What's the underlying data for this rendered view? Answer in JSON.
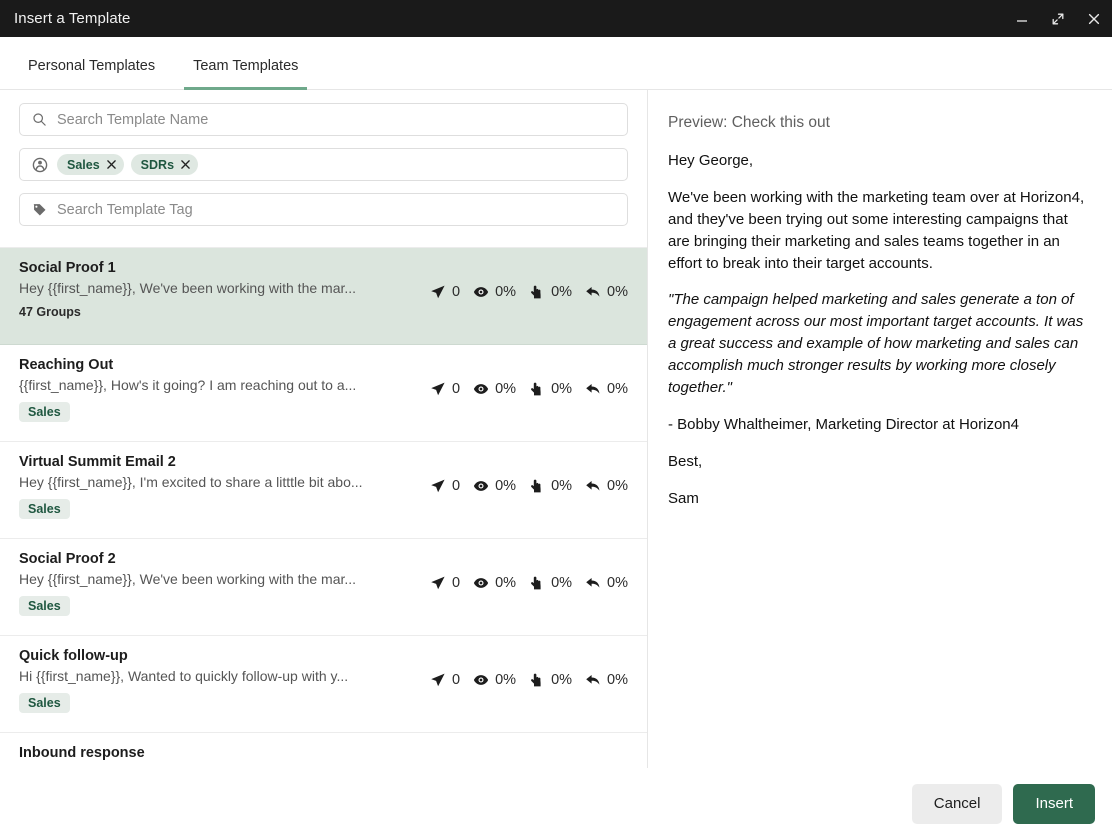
{
  "window": {
    "title": "Insert a Template",
    "controls": [
      {
        "name": "minimize",
        "label": "Minimize"
      },
      {
        "name": "maximize",
        "label": "Maximize"
      },
      {
        "name": "close",
        "label": "Close"
      }
    ]
  },
  "tabs": [
    {
      "label": "Personal Templates",
      "active": false
    },
    {
      "label": "Team Templates",
      "active": true
    }
  ],
  "filters": {
    "name_search": {
      "placeholder": "Search Template Name",
      "value": "",
      "icon": "search-icon"
    },
    "group_filter": {
      "icon": "group-people-icon",
      "chips": [
        {
          "label": "Sales"
        },
        {
          "label": "SDRs"
        }
      ]
    },
    "tag_search": {
      "placeholder": "Search Template Tag",
      "value": "",
      "icon": "tag-icon"
    }
  },
  "stat_labels": {
    "sent": "sent-icon",
    "opened": "eye-icon",
    "clicked": "click-hand-icon",
    "replied": "reply-arrow-icon"
  },
  "templates": [
    {
      "title": "Social Proof 1",
      "snippet": "Hey {{first_name}}, We've been working with the mar...",
      "meta": "47 Groups",
      "meta_type": "groups",
      "selected": true,
      "stats": {
        "sent": "0",
        "opened": "0%",
        "clicked": "0%",
        "replied": "0%"
      }
    },
    {
      "title": "Reaching Out",
      "snippet": "{{first_name}}, How's it going? I am reaching out to a...",
      "meta": "Sales",
      "meta_type": "tag",
      "selected": false,
      "stats": {
        "sent": "0",
        "opened": "0%",
        "clicked": "0%",
        "replied": "0%"
      }
    },
    {
      "title": "Virtual Summit Email 2",
      "snippet": "Hey {{first_name}}, I'm excited to share a litttle bit abo...",
      "meta": "Sales",
      "meta_type": "tag",
      "selected": false,
      "stats": {
        "sent": "0",
        "opened": "0%",
        "clicked": "0%",
        "replied": "0%"
      }
    },
    {
      "title": "Social Proof 2",
      "snippet": "Hey {{first_name}}, We've been working with the mar...",
      "meta": "Sales",
      "meta_type": "tag",
      "selected": false,
      "stats": {
        "sent": "0",
        "opened": "0%",
        "clicked": "0%",
        "replied": "0%"
      }
    },
    {
      "title": "Quick follow-up",
      "snippet": "Hi {{first_name}}, Wanted to quickly follow-up with y...",
      "meta": "Sales",
      "meta_type": "tag",
      "selected": false,
      "stats": {
        "sent": "0",
        "opened": "0%",
        "clicked": "0%",
        "replied": "0%"
      }
    },
    {
      "title": "Inbound response",
      "snippet": "",
      "meta": "",
      "meta_type": "none",
      "selected": false,
      "stats": {
        "sent": "",
        "opened": "",
        "clicked": "",
        "replied": ""
      }
    }
  ],
  "preview": {
    "subject": "Preview: Check this out",
    "paragraphs": [
      {
        "text": "Hey George,",
        "style": "normal"
      },
      {
        "text": "We've been working with the marketing team over at Horizon4, and they've been trying out some interesting campaigns that are bringing their marketing and sales teams together in an effort to break into their target accounts.",
        "style": "normal"
      },
      {
        "text": "\"The campaign helped marketing and sales generate a ton of engagement across our most important target accounts. It was a great success and example of how marketing and sales can accomplish much stronger results by working more closely together.\"",
        "style": "quote"
      },
      {
        "text": "- Bobby Whaltheimer, Marketing Director at Horizon4",
        "style": "normal"
      },
      {
        "text": "Best,",
        "style": "normal"
      },
      {
        "text": "Sam",
        "style": "sig"
      }
    ]
  },
  "footer": {
    "cancel_label": "Cancel",
    "insert_label": "Insert"
  },
  "colors": {
    "titlebar_bg": "#1a1a1a",
    "accent_green": "#6fa98b",
    "insert_button": "#2f6a4f",
    "selected_row": "#dbe5dd",
    "chip_bg": "#dfe8e2",
    "chip_text": "#1f5740"
  }
}
